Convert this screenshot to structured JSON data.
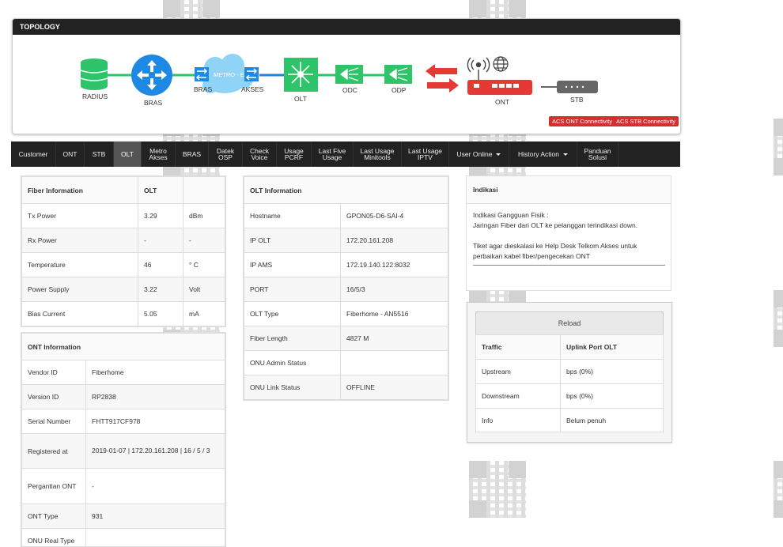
{
  "topology": {
    "title": "TOPOLOGY",
    "nodes": {
      "radius": "RADIUS",
      "bras": "BRAS",
      "bras_small": "BRAS",
      "metro": "METRO - E",
      "akses": "AKSES",
      "olt": "OLT",
      "odc": "ODC",
      "odp": "ODP",
      "ont": "ONT",
      "stb": "STB"
    },
    "buttons": {
      "acs_ont": "ACS ONT Connectivity",
      "acs_stb": "ACS STB Connectivity"
    },
    "colors": {
      "green": "#2ec56a",
      "blue": "#1e88e5",
      "red": "#e53935",
      "line_blue": "#2b7fd0"
    }
  },
  "nav": {
    "tabs": [
      {
        "line1": "Customer",
        "line2": ""
      },
      {
        "line1": "ONT",
        "line2": ""
      },
      {
        "line1": "STB",
        "line2": ""
      },
      {
        "line1": "OLT",
        "line2": ""
      },
      {
        "line1": "Metro",
        "line2": "Akses"
      },
      {
        "line1": "BRAS",
        "line2": ""
      },
      {
        "line1": "Datek",
        "line2": "OSP"
      },
      {
        "line1": "Check",
        "line2": "Voice"
      },
      {
        "line1": "Usage",
        "line2": "PCRF"
      },
      {
        "line1": "Last Five",
        "line2": "Usage"
      },
      {
        "line1": "Last Usage",
        "line2": "Minitools"
      },
      {
        "line1": "Last Usage",
        "line2": "IPTV"
      },
      {
        "line1": "User Online",
        "line2": ""
      },
      {
        "line1": "History Action",
        "line2": ""
      },
      {
        "line1": "Panduan",
        "line2": "Solusi"
      }
    ],
    "active": "OLT"
  },
  "fiber": {
    "header": [
      "Fiber Information",
      "OLT",
      ""
    ],
    "rows": [
      [
        "Tx Power",
        "3.29",
        "dBm"
      ],
      [
        "Rx Power",
        "-",
        "-"
      ],
      [
        "Temperature",
        "46",
        "° C"
      ],
      [
        "Power Supply",
        "3.22",
        "Volt"
      ],
      [
        "Bias Current",
        "5.05",
        "mA"
      ]
    ]
  },
  "ont_info": {
    "header": "ONT Information",
    "rows": [
      [
        "Vendor ID",
        "Fiberhome"
      ],
      [
        "Version ID",
        "RP2838"
      ],
      [
        "Serial Number",
        "FHTT917CF978"
      ],
      [
        "Registered at",
        "2019-01-07 | 172.20.161.208 | 16 / 5 / 3"
      ],
      [
        "Pergantian ONT",
        "-"
      ],
      [
        "ONT Type",
        "931"
      ],
      [
        "ONU Real Type",
        ""
      ]
    ]
  },
  "olt_info": {
    "header": "OLT Information",
    "rows": [
      [
        "Hostname",
        "GPON05-D6-SAI-4"
      ],
      [
        "IP OLT",
        "172.20.161.208"
      ],
      [
        "IP AMS",
        "172.19.140.122:8032"
      ],
      [
        "PORT",
        "16/5/3"
      ],
      [
        "OLT Type",
        "Fiberhome - AN5516"
      ],
      [
        "Fiber Length",
        "4827 M"
      ],
      [
        "ONU Admin Status",
        ""
      ],
      [
        "ONU Link Status",
        "OFFLINE"
      ]
    ]
  },
  "indikasi": {
    "header": "Indikasi",
    "line1": "Indikasi Gangguan Fisik :",
    "line2": "Jaringan Fiber dari OLT ke pelanggan terindikasi down.",
    "line3": "Tiket agar dieskalasi ke Help Desk Telkom Akses untuk",
    "line4": "perbaikan kabel fiber/pengecekan ONT"
  },
  "traffic": {
    "reload_label": "Reload",
    "header": [
      "Traffic",
      "Uplink Port OLT"
    ],
    "rows": [
      [
        "Upstream",
        "bps (0%)"
      ],
      [
        "Downstream",
        "bps (0%)"
      ],
      [
        "Info",
        "Belum penuh"
      ]
    ]
  }
}
